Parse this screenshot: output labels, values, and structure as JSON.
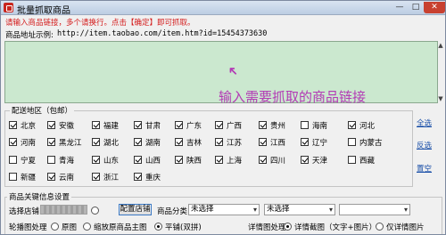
{
  "window": {
    "title": "批量抓取商品",
    "min_label": "—",
    "max_label": "□",
    "close_label": "✕"
  },
  "hint": "请输入商品链接，多个请换行。点击【确定】即可抓取。",
  "example": {
    "label": "商品地址示例:",
    "url": "http://item.taobao.com/item.htm?id=15454373630"
  },
  "url_input": {
    "value": ""
  },
  "annotation": "输入需要抓取的商品链接",
  "region": {
    "title": "配送地区（包邮）",
    "rows": [
      [
        {
          "label": "北京",
          "checked": true
        },
        {
          "label": "安徽",
          "checked": true
        },
        {
          "label": "福建",
          "checked": true
        },
        {
          "label": "甘肃",
          "checked": true
        },
        {
          "label": "广东",
          "checked": true
        },
        {
          "label": "广西",
          "checked": true
        },
        {
          "label": "贵州",
          "checked": true
        },
        {
          "label": "海南",
          "checked": false
        },
        {
          "label": "河北",
          "checked": true
        }
      ],
      [
        {
          "label": "河南",
          "checked": true
        },
        {
          "label": "黑龙江",
          "checked": true
        },
        {
          "label": "湖北",
          "checked": true
        },
        {
          "label": "湖南",
          "checked": true
        },
        {
          "label": "吉林",
          "checked": true
        },
        {
          "label": "江苏",
          "checked": true
        },
        {
          "label": "江西",
          "checked": true
        },
        {
          "label": "辽宁",
          "checked": true
        },
        {
          "label": "内蒙古",
          "checked": false
        }
      ],
      [
        {
          "label": "宁夏",
          "checked": false
        },
        {
          "label": "青海",
          "checked": false
        },
        {
          "label": "山东",
          "checked": true
        },
        {
          "label": "山西",
          "checked": true
        },
        {
          "label": "陕西",
          "checked": true
        },
        {
          "label": "上海",
          "checked": true
        },
        {
          "label": "四川",
          "checked": true
        },
        {
          "label": "天津",
          "checked": true
        },
        {
          "label": "西藏",
          "checked": false
        }
      ],
      [
        {
          "label": "新疆",
          "checked": false
        },
        {
          "label": "云南",
          "checked": true
        },
        {
          "label": "浙江",
          "checked": true
        },
        {
          "label": "重庆",
          "checked": true
        }
      ]
    ],
    "select_all": "全选",
    "invert": "反选",
    "clear": "置空"
  },
  "keyword": {
    "title": "商品关键信息设置",
    "store_label": "选择店铺",
    "store_button": "配置店铺",
    "category_label": "商品分类",
    "category_select": "未选择",
    "category_select_2": "未选择",
    "carousel_label": "轮播图处理",
    "carousel_options": [
      {
        "label": "原图",
        "selected": false
      },
      {
        "label": "缩放原商品主图",
        "selected": false
      },
      {
        "label": "平铺(双拼)",
        "selected": true
      }
    ],
    "detail_label": "详情图处理",
    "detail_options": [
      {
        "label": "详情截图（文字+图片）",
        "selected": true
      },
      {
        "label": "仅详情图片",
        "selected": false
      }
    ]
  }
}
